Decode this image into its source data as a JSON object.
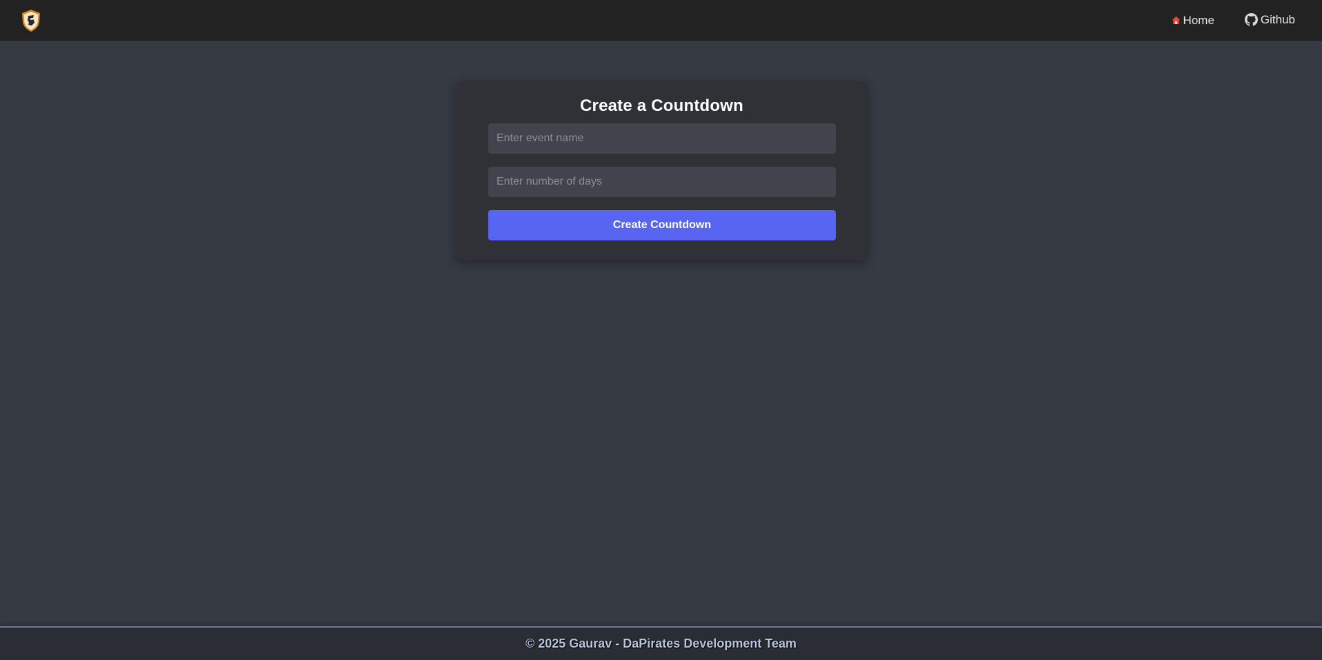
{
  "navbar": {
    "logo_icon": "shield-logo-icon",
    "links": [
      {
        "label": "Home",
        "icon": "house-icon"
      },
      {
        "label": "Github",
        "icon": "github-icon"
      }
    ]
  },
  "form": {
    "title": "Create a Countdown",
    "event_name": {
      "value": "",
      "placeholder": "Enter event name"
    },
    "days": {
      "value": "",
      "placeholder": "Enter number of days"
    },
    "submit_label": "Create Countdown"
  },
  "footer": {
    "text": "© 2025 Gaurav - DaPirates Development Team"
  },
  "colors": {
    "page_bg": "#363a43",
    "navbar_bg": "#222222",
    "card_bg": "#2f3137",
    "input_bg": "#41444c",
    "accent": "#5865f2",
    "footer_bg": "#2a2d33"
  }
}
